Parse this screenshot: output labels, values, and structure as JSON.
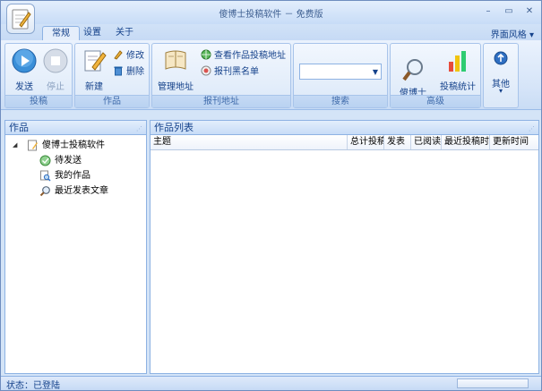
{
  "window": {
    "title": "傻博士投稿软件 － 免费版",
    "controls": {
      "minimize": "–",
      "maximize": "▭",
      "close": "✕"
    }
  },
  "tabs": [
    {
      "label": "常规",
      "active": true
    },
    {
      "label": "设置",
      "active": false
    },
    {
      "label": "关于",
      "active": false
    }
  ],
  "skin_menu": {
    "label": "界面风格",
    "arrow": "▾"
  },
  "ribbon": {
    "groups": {
      "submit": {
        "label": "投稿",
        "send": "发送",
        "stop": "停止"
      },
      "works": {
        "label": "作品",
        "new": "新建",
        "edit": "修改",
        "delete": "删除"
      },
      "journals": {
        "label": "报刊地址",
        "manage": "管理地址",
        "view_address": "查看作品投稿地址",
        "blacklist": "报刊黑名单"
      },
      "search": {
        "label": "搜索",
        "combo_value": ""
      },
      "advanced": {
        "label": "高级",
        "search_engine": "傻博士\n搜索引擎",
        "stats": "投稿统计"
      },
      "other": {
        "label": "其他",
        "arrow": "▾"
      }
    }
  },
  "left_panel": {
    "title": "作品",
    "tree": {
      "root": "傻博士投稿软件",
      "children": [
        "待发送",
        "我的作品",
        "最近发表文章"
      ]
    }
  },
  "right_panel": {
    "title": "作品列表",
    "columns": [
      "主题",
      "总计投稿",
      "发表",
      "已阅读",
      "最近投稿时间",
      "更新时间"
    ]
  },
  "status": {
    "text": "状态：已登陆"
  },
  "colors": {
    "accent": "#15428b",
    "border": "#8db2e3"
  }
}
